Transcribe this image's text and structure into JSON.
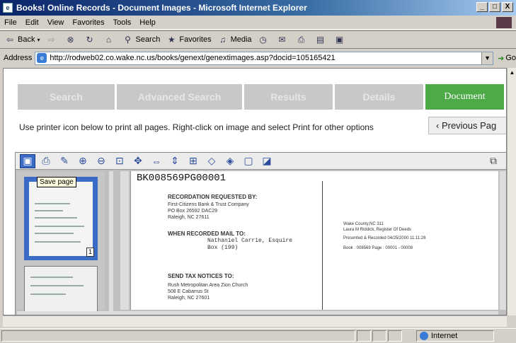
{
  "window": {
    "title": "Books! Online Records - Document Images - Microsoft Internet Explorer",
    "minimize": "_",
    "maximize": "□",
    "close": "X"
  },
  "menu": [
    "File",
    "Edit",
    "View",
    "Favorites",
    "Tools",
    "Help"
  ],
  "toolbar": {
    "back": "Back",
    "search": "Search",
    "favorites": "Favorites",
    "media": "Media"
  },
  "address": {
    "label": "Address",
    "url": "http://rodweb02.co.wake.nc.us/books/genext/genextimages.asp?docid=105165421",
    "go": "Go"
  },
  "nav_tabs": [
    {
      "label": "Search",
      "active": false
    },
    {
      "label": "Advanced Search",
      "active": false
    },
    {
      "label": "Results",
      "active": false
    },
    {
      "label": "Details",
      "active": false
    },
    {
      "label": "Document",
      "active": true
    }
  ],
  "instruction": "Use printer icon below to print all pages. Right-click on image and select Print for other options",
  "prev_button": "‹ Previous Pag",
  "viewer": {
    "tooltip": "Save page",
    "thumb_page_number": "1",
    "doc_id": "BK008569PG00001",
    "left_page": {
      "recordation": "RECORDATION REQUESTED BY:",
      "bank_lines": [
        "First-Citizens Bank & Trust Company",
        "PO Box 26592 DAC29",
        "Raleigh, NC 27611"
      ],
      "mail_to": "WHEN RECORDED MAIL TO:",
      "mail_lines": [
        "Nathaniel Carrie, Esquire",
        "Box (199)"
      ],
      "tax_notices": "SEND TAX NOTICES TO:",
      "tax_lines": [
        "Rush Metropolitan Area Zion Church",
        "508 E Cabarrus St",
        "Raleigh, NC 27601"
      ]
    },
    "right_page": {
      "lines": [
        "Wake County,NC 311",
        "Laura M Riddick, Register Of Deeds",
        "Presented & Recorded 04/25/2000 11:11:26",
        "Book : 008569 Page : 00001 - 00008"
      ]
    }
  },
  "status": {
    "zone": "Internet"
  }
}
